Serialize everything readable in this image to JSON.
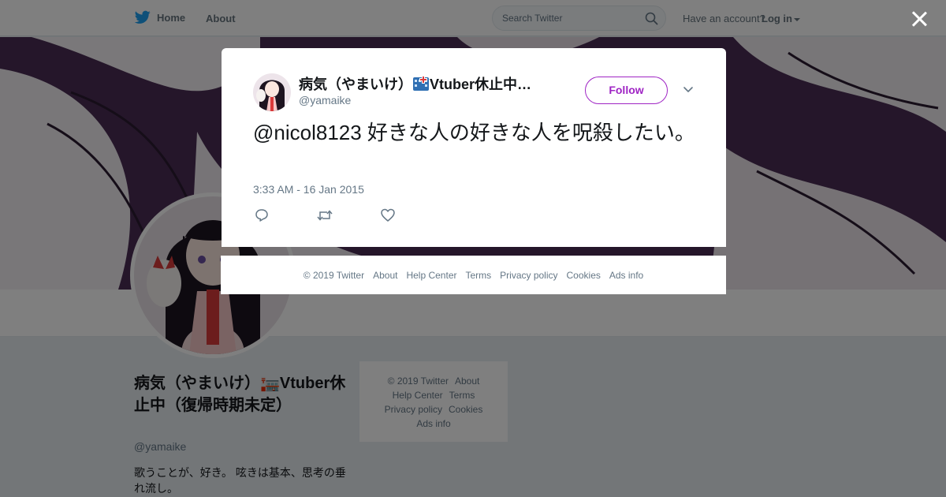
{
  "topbar": {
    "home_label": "Home",
    "about_label": "About",
    "search_placeholder": "Search Twitter",
    "have_account": "Have an account?",
    "login_label": "Log in"
  },
  "colors": {
    "twitter_blue": "#1da1f2",
    "follow_accent": "#9f24c4",
    "banner_dark": "#3a2540"
  },
  "profile": {
    "name": "病気（やまいけ）🏣Vtuber休止中（復帰時期未定）",
    "handle": "@yamaike",
    "bio": "歌うことが、好き。 呟きは基本、思考の垂れ流し。"
  },
  "side_footer": {
    "copyright": "© 2019 Twitter",
    "about": "About",
    "help_center": "Help Center",
    "terms": "Terms",
    "privacy": "Privacy policy",
    "cookies": "Cookies",
    "ads_info": "Ads info"
  },
  "tweet": {
    "author_name": "病気（やまいけ）🏣Vtuber休止中…",
    "author_name_display": "病気（やまいけ）",
    "author_name_tail": "Vtuber休止中…",
    "author_handle": "@yamaike",
    "follow_label": "Follow",
    "text": "@nicol8123 好きな人の好きな人を呪殺したい。",
    "timestamp": "3:33 AM - 16 Jan 2015",
    "icons": [
      "reply-icon",
      "retweet-icon",
      "like-icon"
    ]
  },
  "modal_footer": {
    "copyright": "© 2019 Twitter",
    "about": "About",
    "help_center": "Help Center",
    "terms": "Terms",
    "privacy": "Privacy policy",
    "cookies": "Cookies",
    "ads_info": "Ads info"
  }
}
